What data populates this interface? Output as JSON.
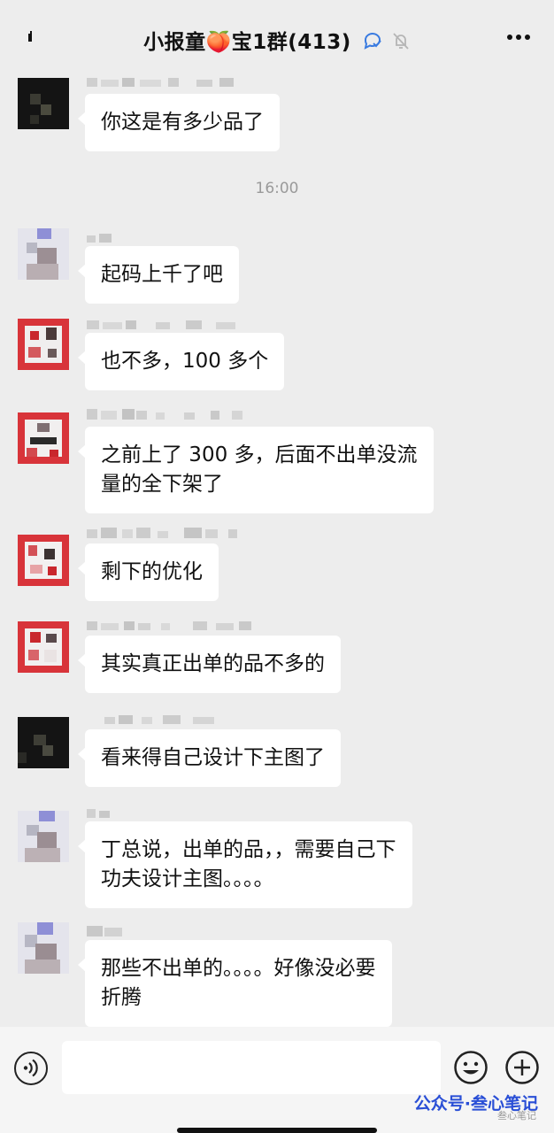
{
  "header": {
    "title": "小报童🍑宝1群(413)",
    "back_icon": "back-arrow-icon",
    "more_icon": "more-dots-icon"
  },
  "time_divider": "16:00",
  "messages": [
    {
      "text": "你这是有多少品了",
      "avatar_style": "dark"
    },
    {
      "text": "起码上千了吧",
      "avatar_style": "light"
    },
    {
      "text": "也不多，100 多个",
      "avatar_style": "red"
    },
    {
      "text": "之前上了 300 多，后面不出单没流\n量的全下架了",
      "avatar_style": "red"
    },
    {
      "text": "剩下的优化",
      "avatar_style": "red"
    },
    {
      "text": "其实真正出单的品不多的",
      "avatar_style": "red"
    },
    {
      "text": "看来得自己设计下主图了",
      "avatar_style": "dark"
    },
    {
      "text": "丁总说，出单的品，，需要自己下\n功夫设计主图。。。。",
      "avatar_style": "light"
    },
    {
      "text": "那些不出单的。。。。好像没必要\n折腾",
      "avatar_style": "light"
    }
  ],
  "input_bar": {
    "voice_icon": "voice-icon",
    "emoji_icon": "emoji-icon",
    "plus_icon": "plus-icon",
    "watermark": "公众号·叁心笔记",
    "watermark_small": "叁心笔记"
  },
  "colors": {
    "background": "#ededed",
    "bubble": "#ffffff",
    "watermark": "#2a4fd6"
  }
}
